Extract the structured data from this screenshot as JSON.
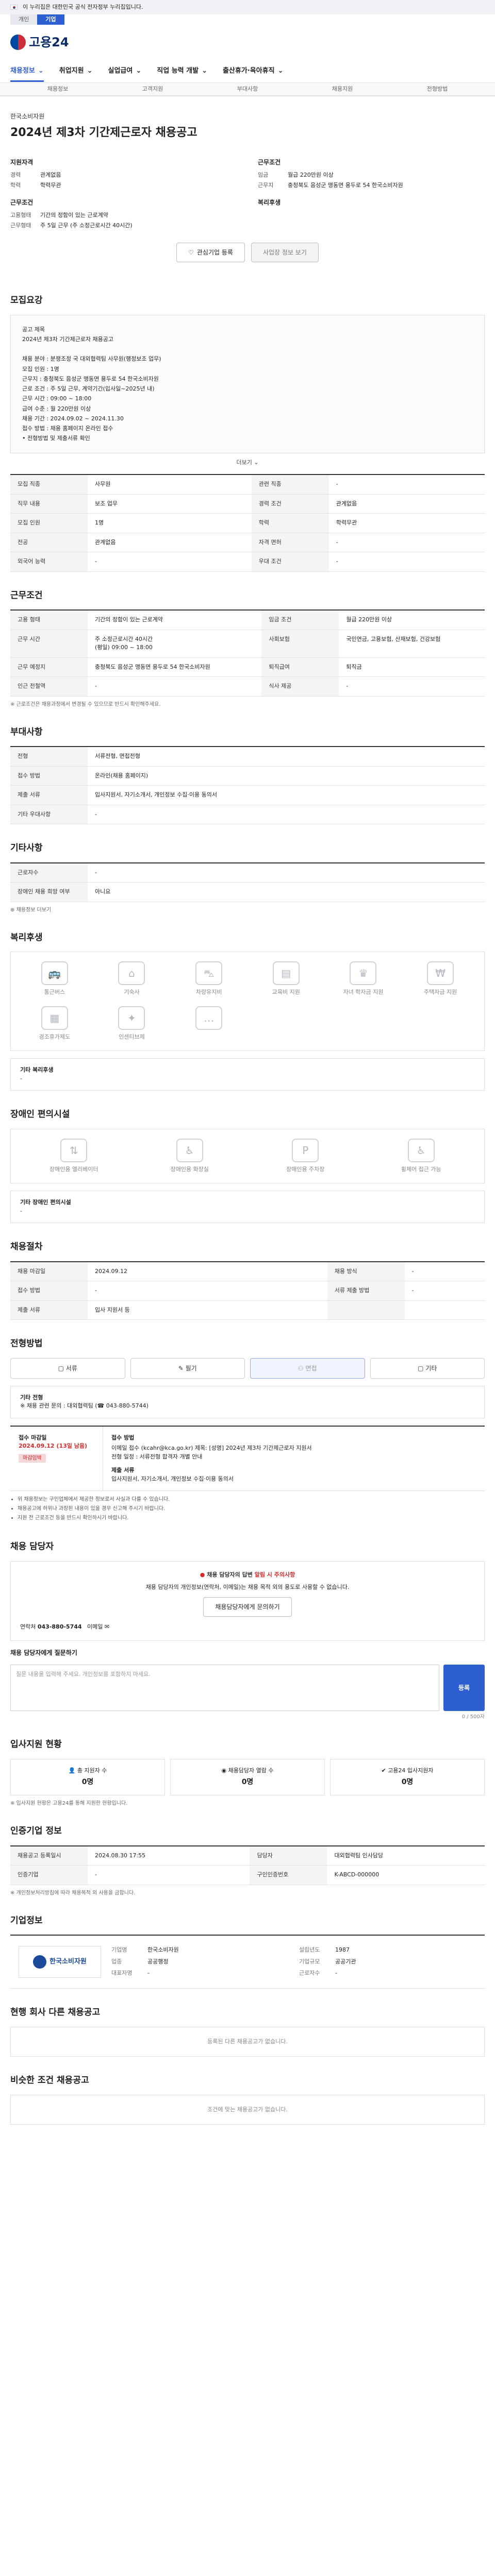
{
  "topbar": {
    "gov_notice": "이 누리집은 대한민국 공식 전자정부 누리집입니다."
  },
  "tabs": [
    {
      "label": "개인",
      "active": false
    },
    {
      "label": "기업",
      "active": true
    }
  ],
  "brand": {
    "logo_text": "고용24"
  },
  "gnb": [
    {
      "label": "채용정보",
      "active": true
    },
    {
      "label": "취업지원",
      "active": false
    },
    {
      "label": "실업급여",
      "active": false
    },
    {
      "label": "직업 능력 개발",
      "active": false
    },
    {
      "label": "출산휴가·육아휴직",
      "active": false
    }
  ],
  "subnav": [
    "채용정보",
    "고객지원",
    "부대사항",
    "채용지원",
    "전형방법"
  ],
  "hero": {
    "org": "한국소비자원",
    "title": "2024년 제3차 기간제근로자 채용공고",
    "left_heading": "지원자격",
    "left_rows": [
      {
        "k": "경력",
        "v": "관계없음"
      },
      {
        "k": "학력",
        "v": "학력무관"
      }
    ],
    "left_heading2": "근무조건",
    "left_rows2": [
      {
        "k": "고용형태",
        "v": "기간의 정함이 있는 근로계약"
      },
      {
        "k": "근무형태",
        "v": "주 5일 근무 (주 소정근로시간 40시간)"
      }
    ],
    "right_heading": "근무조건",
    "right_rows": [
      {
        "k": "임금",
        "v": "월급 220만원 이상"
      },
      {
        "k": "근무지",
        "v": "충청북도 음성군 맹동면 용두로 54 한국소비자원"
      }
    ],
    "right_heading2": "복리후생",
    "btn_apply": "관심기업 등록",
    "btn_print": "사업장 정보 보기"
  },
  "recruit_info": {
    "heading": "모집요강",
    "text": "공고 제목\n2024년 제3차 기간제근로자 채용공고\n\n채용 분야 : 분쟁조정 국 대외협력팀 사무원(행정보조 업무)\n모집 인원 : 1명\n근무지 : 충청북도 음성군 맹동면 용두로 54 한국소비자원\n근로 조건 : 주 5일 근무, 계약기간(입사일~2025년 내)\n근무 시간 : 09:00 ~ 18:00\n급여 수준 : 월 220만원 이상\n채용 기간 : 2024.09.02 ~ 2024.11.30\n접수 방법 : 채용 홈페이지 온라인 접수\n• 전형방법 및 제출서류 확인",
    "more": "더보기"
  },
  "recruit_table": [
    {
      "k": "모집 직종",
      "v": "사무원",
      "k2": "관련 직종",
      "v2": "-"
    },
    {
      "k": "직무 내용",
      "v": "보조 업무",
      "k2": "경력 조건",
      "v2": "관계없음"
    },
    {
      "k": "모집 인원",
      "v": "1명",
      "k2": "학력",
      "v2": "학력무관"
    },
    {
      "k": "전공",
      "v": "관계없음",
      "k2": "자격 면허",
      "v2": "-"
    },
    {
      "k": "외국어 능력",
      "v": "-",
      "k2": "우대 조건",
      "v2": "-"
    }
  ],
  "conditions": {
    "heading": "근무조건",
    "rows": [
      {
        "k": "고용 형태",
        "v": "기간의 정함이 있는 근로계약",
        "k2": "임금 조건",
        "v2": "월급 220만원 이상"
      },
      {
        "k": "근무 시간",
        "v": "주 소정근로시간 40시간\n(평일) 09:00 ~ 18:00",
        "k2": "사회보험",
        "v2": "국민연금, 고용보험, 산재보험, 건강보험"
      },
      {
        "k": "근무 예정지",
        "v": "충청북도 음성군 맹동면 용두로 54 한국소비자원",
        "k2": "퇴직급여",
        "v2": "퇴직금"
      },
      {
        "k": "인근 전철역",
        "v": "-",
        "k2": "식사 제공",
        "v2": "-"
      }
    ],
    "note": "※ 근로조건은 채용과정에서 변경될 수 있으므로 반드시 확인해주세요."
  },
  "extra": {
    "heading": "부대사항",
    "rows": [
      {
        "k": "전형",
        "v": "서류전형, 면접전형"
      },
      {
        "k": "접수 방법",
        "v": "온라인(채용 홈페이지)"
      },
      {
        "k": "제출 서류",
        "v": "입사지원서, 자기소개서, 개인정보 수집·이용 동의서"
      },
      {
        "k": "기타 우대사항",
        "v": "-"
      }
    ]
  },
  "other_info": {
    "heading": "기타사항",
    "rows": [
      {
        "k": "근로자수",
        "v": "-"
      },
      {
        "k": "장애인 채용 희망 여부",
        "v": "아니요"
      }
    ],
    "link": "채용정보 더보기"
  },
  "welfare": {
    "heading": "복리후생",
    "items": [
      "통근버스",
      "기숙사",
      "차량유지비",
      "교육비 지원",
      "자녀 학자금 지원",
      "주택자금 지원",
      "경조휴가제도",
      "인센티브제",
      ""
    ],
    "note_label": "기타 복리후생",
    "note_value": "-"
  },
  "disability": {
    "heading": "장애인 편의시설",
    "items": [
      "장애인용 엘리베이터",
      "장애인용 화장실",
      "장애인용 주차장",
      "휠체어 접근 가능"
    ],
    "note_label": "기타 장애인 편의시설",
    "note_value": "-"
  },
  "process": {
    "heading": "채용절차",
    "rows": [
      {
        "k": "채용 마감일",
        "v": "2024.09.12",
        "k2": "채용 방식",
        "v2": "-"
      },
      {
        "k": "접수 방법",
        "v": "-",
        "k2": "서류 제출 방법",
        "v2": "-"
      },
      {
        "k": "제출 서류",
        "v": "입사 지원서 등",
        "k2": "",
        "v2": ""
      }
    ]
  },
  "apply_method": {
    "heading": "전형방법",
    "buttons": [
      "서류",
      "필기",
      "면접",
      "기타"
    ],
    "box_label": "기타 전형",
    "box_text": "※ 채용 관련 문의 : 대외협력팀 (☎ 043-880-5744)"
  },
  "apply_period": {
    "heading": "접수 기간",
    "left_title": "접수 마감일",
    "left_date": "2024.09.12 (13일 남음)",
    "left_tag": "마감임박",
    "right_title": "접수 방법",
    "right_text": "이메일 접수 (kcahr@kca.go.kr) 제목: [성명] 2024년 제3차 기간제근로자 지원서\n전형 일정 : 서류전형 합격자 개별 안내",
    "right_sub_title": "제출 서류",
    "right_sub_text": "입사지원서, 자기소개서, 개인정보 수집·이용 동의서"
  },
  "apply_notes": [
    "위 채용정보는 구인업체에서 제공한 정보로서 사실과 다를 수 있습니다.",
    "채용공고에 허위나 과장된 내용이 있을 경우 신고해 주시기 바랍니다.",
    "지원 전 근로조건 등을 반드시 확인하시기 바랍니다."
  ],
  "qna": {
    "heading": "채용 담당자",
    "warn_pre": "채용 담당자의 답변 ",
    "warn_em": "알림 시 주의사항",
    "body": "채용 담당자의 개인정보(연락처, 이메일)는 채용 목적 외의 용도로 사용할 수 없습니다.",
    "btn": "채용담당자에게 문의하기",
    "contact_label": "연락처",
    "contact_value": "043-880-5744",
    "contact2_label": "이메일"
  },
  "chat": {
    "heading": "채용 담당자에게 질문하기",
    "placeholder": "질문 내용을 입력해 주세요. 개인정보를 포함하지 마세요.",
    "count": "0 / 500자",
    "send": "등록"
  },
  "status": {
    "heading": "입사지원 현황",
    "cards": [
      {
        "k": "총 지원자 수",
        "v": "0명"
      },
      {
        "k": "채용담당자 열람 수",
        "v": "0명"
      },
      {
        "k": "고용24 입사지원자",
        "v": "0명"
      }
    ],
    "note": "※ 입사지원 현황은 고용24를 통해 지원한 현황입니다."
  },
  "registration": {
    "heading": "인증기업 정보",
    "rows": [
      {
        "k": "채용공고 등록일시",
        "v": "2024.08.30 17:55",
        "k2": "담당자",
        "v2": "대외협력팀 인사담당"
      },
      {
        "k": "인증기업",
        "v": "-",
        "k2": "구인인증번호",
        "v2": "K-ABCD-000000"
      }
    ],
    "note": "※ 개인정보처리방침에 따라 채용목적 외 사용을 금합니다."
  },
  "company": {
    "heading": "기업정보",
    "logo_text": "한국소비자원",
    "rows": [
      {
        "k": "기업명",
        "v": "한국소비자원"
      },
      {
        "k": "업종",
        "v": "공공행정"
      },
      {
        "k": "대표자명",
        "v": "-"
      },
      {
        "k": "설립년도",
        "v": "1987"
      },
      {
        "k": "기업규모",
        "v": "공공기관"
      },
      {
        "k": "근로자수",
        "v": "-"
      }
    ]
  },
  "same_company": {
    "heading": "현행 회사 다른 채용공고",
    "empty": "등록된 다른 채용공고가 없습니다."
  },
  "similar": {
    "heading": "비슷한 조건 채용공고",
    "empty": "조건에 맞는 채용공고가 없습니다."
  },
  "colors": {
    "primary": "#2d5fd1",
    "red": "#d6292a",
    "header_bg": "#f0f2f5"
  }
}
